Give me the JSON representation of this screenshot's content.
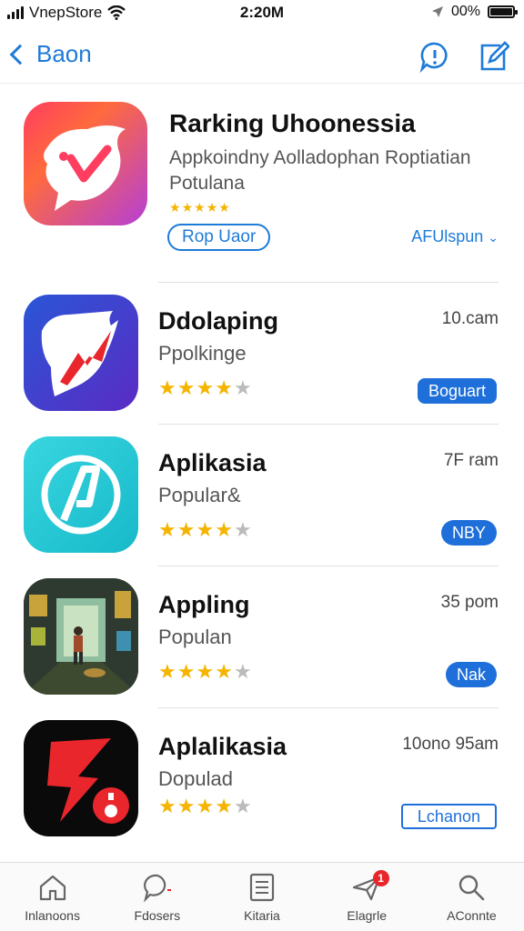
{
  "status_bar": {
    "carrier": "VnepStore",
    "time": "2:20M",
    "battery_percent": "00%"
  },
  "nav": {
    "back_label": "Baon"
  },
  "featured": {
    "title": "Rarking Uhoonessia",
    "subtitle": "Appkoindny Aolladophan Roptiatian Potulana",
    "rating": 5,
    "primary_button": "Rop Uaor",
    "secondary_link": "AFUlspun"
  },
  "apps": [
    {
      "title": "Ddolaping",
      "subtitle": "Ppolkinge",
      "meta": "10.cam",
      "rating": 4,
      "button": "Boguart",
      "button_style": "filled"
    },
    {
      "title": "Aplikasia",
      "subtitle": "Popular&",
      "meta": "7F ram",
      "rating": 4,
      "button": "NBY",
      "button_style": "filled"
    },
    {
      "title": "Appling",
      "subtitle": "Populan",
      "meta": "35 pom",
      "rating": 4,
      "button": "Nak",
      "button_style": "filled"
    },
    {
      "title": "Aplalikasia",
      "subtitle": "Dopulad",
      "meta": "10ono 95am",
      "rating": 4,
      "button": "Lchanon",
      "button_style": "outline"
    }
  ],
  "tabs": [
    {
      "label": "Inlanoons",
      "icon": "home-icon"
    },
    {
      "label": "Fdosers",
      "icon": "chat-icon"
    },
    {
      "label": "Kitaria",
      "icon": "list-icon"
    },
    {
      "label": "Elagrle",
      "icon": "plane-icon",
      "badge": "1"
    },
    {
      "label": "AConnte",
      "icon": "search-icon"
    }
  ],
  "colors": {
    "accent": "#1e7bd8",
    "button_fill": "#1e6fd9",
    "star": "#f5b400",
    "badge": "#e8262c"
  }
}
